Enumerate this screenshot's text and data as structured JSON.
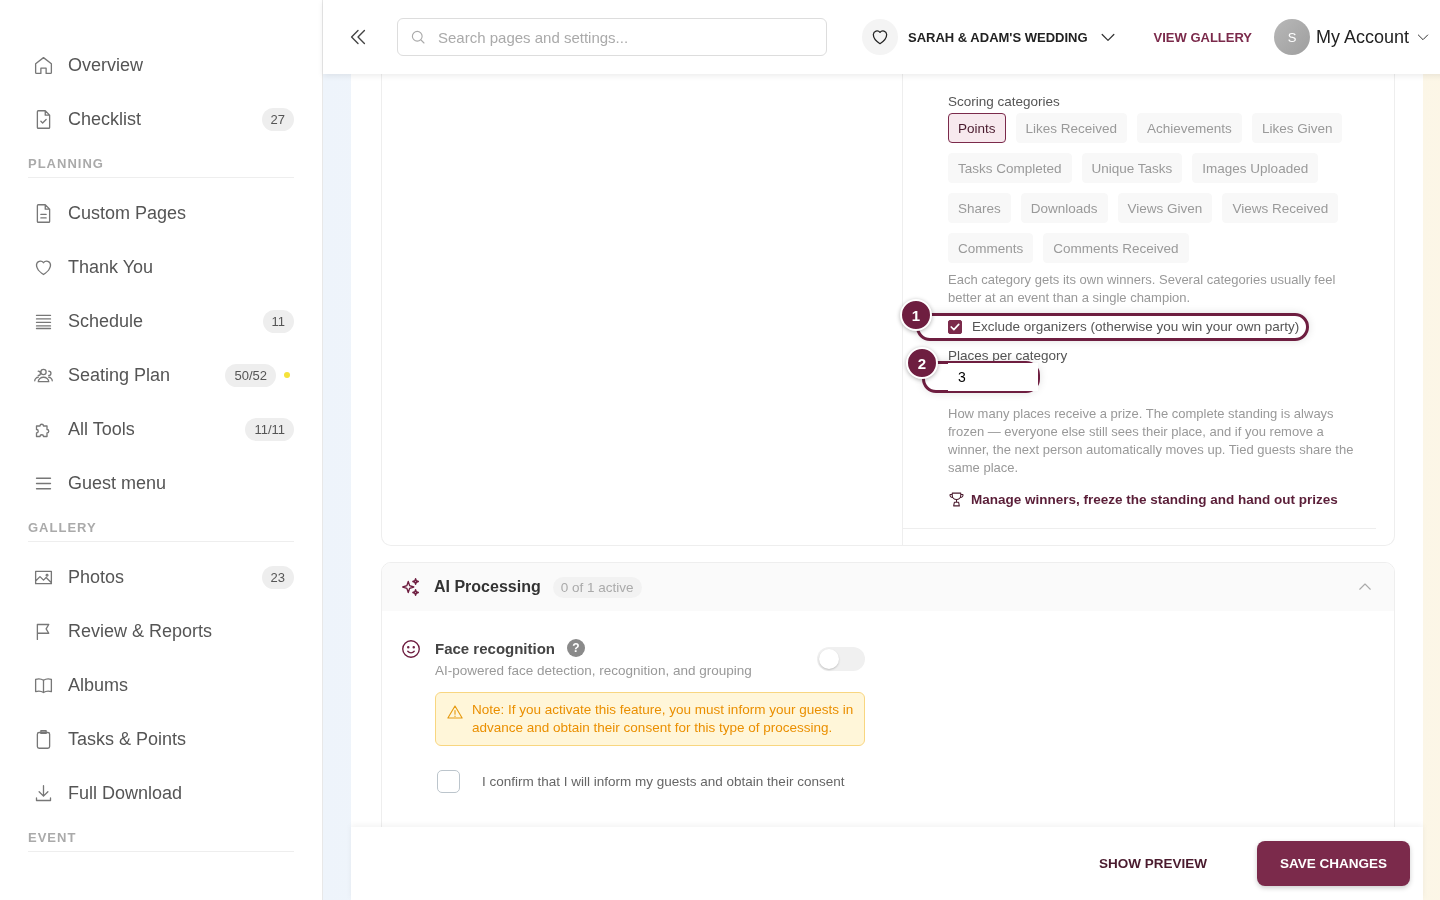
{
  "sidebar": {
    "sections": [
      {
        "items": [
          {
            "label": "Overview"
          },
          {
            "label": "Checklist",
            "count": "27"
          }
        ]
      },
      {
        "heading": "PLANNING",
        "items": [
          {
            "label": "Custom Pages"
          },
          {
            "label": "Thank You"
          },
          {
            "label": "Schedule",
            "count": "11"
          },
          {
            "label": "Seating Plan",
            "count": "50/52",
            "color": "#f5e23a"
          },
          {
            "label": "All Tools",
            "count": "11/11"
          },
          {
            "label": "Guest menu"
          }
        ]
      },
      {
        "heading": "GALLERY",
        "items": [
          {
            "label": "Photos",
            "count": "23"
          },
          {
            "label": "Review & Reports"
          },
          {
            "label": "Albums"
          },
          {
            "label": "Tasks & Points"
          },
          {
            "label": "Full Download"
          }
        ]
      },
      {
        "heading": "EVENT"
      }
    ]
  },
  "header": {
    "search": {
      "placeholder": "Search pages and settings..."
    },
    "event_name": "SARAH & ADAM'S WEDDING",
    "view_gallery": "VIEW GALLERY",
    "avatar_initial": "S",
    "account": "My Account"
  },
  "leaderboard": {
    "categories_label": "Scoring categories",
    "categories": [
      {
        "label": "Points",
        "selected": true
      },
      {
        "label": "Likes Received",
        "selected": false
      },
      {
        "label": "Achievements",
        "selected": false
      },
      {
        "label": "Likes Given",
        "selected": false
      },
      {
        "label": "Tasks Completed",
        "selected": false
      },
      {
        "label": "Unique Tasks",
        "selected": false
      },
      {
        "label": "Images Uploaded",
        "selected": false
      },
      {
        "label": "Shares",
        "selected": false
      },
      {
        "label": "Downloads",
        "selected": false
      },
      {
        "label": "Views Given",
        "selected": false
      },
      {
        "label": "Views Received",
        "selected": false
      },
      {
        "label": "Comments",
        "selected": false
      },
      {
        "label": "Comments Received",
        "selected": false
      }
    ],
    "categories_help": "Each category gets its own winners. Several categories usually feel better at an event than a single champion.",
    "exclude_organizers": {
      "label": "Exclude organizers (otherwise you win your own party)",
      "checked": true,
      "annotation": "1"
    },
    "places": {
      "label": "Places per category",
      "value": "3",
      "annotation": "2"
    },
    "places_help": "How many places receive a prize. The complete standing is always frozen — everyone else still sees their place, and if you remove a winner, the next person automatically moves up. Tied guests share the same place.",
    "manage_link": "Manage winners, freeze the standing and hand out prizes"
  },
  "ai_processing": {
    "title": "AI Processing",
    "badge": "0 of 1 active",
    "expanded": true,
    "feature": {
      "title": "Face recognition",
      "help": "?",
      "description": "AI-powered face detection, recognition, and grouping",
      "on": false,
      "warning": "Note: If you activate this feature, you must inform your guests in advance and obtain their consent for this type of processing.",
      "confirm": {
        "label": "I confirm that I will inform my guests and obtain their consent",
        "checked": false
      }
    }
  },
  "footer": {
    "preview": "SHOW PREVIEW",
    "save": "SAVE CHANGES"
  }
}
